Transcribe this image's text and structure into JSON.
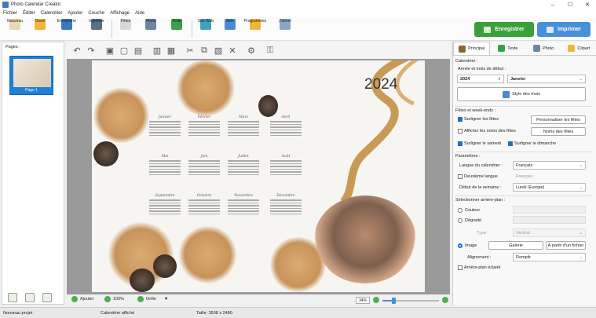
{
  "window": {
    "title": "Photo Calendar Creator",
    "controls": [
      "–",
      "☐",
      "✕"
    ]
  },
  "menu": [
    "Fichier",
    "Éditer",
    "Calendrier",
    "Ajouter",
    "Couche",
    "Affichage",
    "Aide"
  ],
  "toolbar": {
    "buttons": [
      {
        "label": "Nouveau",
        "icon": "new-file-icon",
        "color": "#e9d9b0"
      },
      {
        "label": "Ouvrir",
        "icon": "open-folder-icon",
        "color": "#f0b53a"
      },
      {
        "label": "Enregistrer",
        "icon": "save-icon",
        "color": "#3b78c6"
      },
      {
        "label": "Imprimer",
        "icon": "print-icon",
        "color": "#5a6e8a"
      },
      {
        "label": "Fêtes",
        "icon": "holidays-icon",
        "color": "#d8d8d8"
      },
      {
        "label": "Photo",
        "icon": "photo-icon",
        "color": "#6e86a3"
      },
      {
        "label": "Texte",
        "icon": "text-icon",
        "color": "#3aa04a"
      },
      {
        "label": "Site Web",
        "icon": "website-icon",
        "color": "#3fa1c4"
      },
      {
        "label": "Aide",
        "icon": "help-icon",
        "color": "#4a8ad6"
      },
      {
        "label": "Programmes",
        "icon": "programs-icon",
        "color": "#f0b53a"
      },
      {
        "label": "J'aime!",
        "icon": "like-icon",
        "color": "#8aa6c8"
      }
    ],
    "save_label": "Enregistrer",
    "print_label": "Imprimer"
  },
  "pages_panel": {
    "header": "Pages :",
    "thumb_label": "Page 1"
  },
  "page": {
    "year": "2024",
    "months": [
      "Janvier",
      "Février",
      "Mars",
      "Avril",
      "Mai",
      "Juin",
      "Juillet",
      "Août",
      "Septembre",
      "Octobre",
      "Novembre",
      "Décembre"
    ]
  },
  "canvas_status": {
    "add_label": "Ajouter",
    "zoom_label": "100%",
    "grid_label": "Grille",
    "zoom_value": "34%",
    "zoom_slider_fraction": 0.2
  },
  "statusbar": {
    "project": "Nouveau projet",
    "displayed": "Calendrier affiché",
    "size": "Taille: 3508 x 2480"
  },
  "right_panel": {
    "tabs": [
      {
        "label": "Principal",
        "icon": "main-tab-icon",
        "color": "#8a6a2a"
      },
      {
        "label": "Texte",
        "icon": "text-tab-icon",
        "color": "#3aa04a"
      },
      {
        "label": "Photo",
        "icon": "photo-tab-icon",
        "color": "#6e86a3"
      },
      {
        "label": "Clipart",
        "icon": "clipart-tab-icon",
        "color": "#f0b53a"
      }
    ],
    "calendar": {
      "section": "Calendrier :",
      "year_month_label": "Année et mois de début :",
      "year": "2024",
      "month": "Janvier",
      "style_button": "Style des mois"
    },
    "holidays": {
      "section": "Fêtes et week-ends :",
      "highlight_holidays": "Surligner les fêtes",
      "customize_holidays": "Personnaliser les fêtes",
      "show_names": "Afficher les noms des fêtes",
      "holiday_names": "Noms des fêtes",
      "highlight_saturday": "Surligner le samedi",
      "highlight_sunday": "Surligner le dimanche"
    },
    "params": {
      "section": "Paramètres :",
      "language_label": "Langue du calendrier :",
      "language_value": "Français",
      "second_language": "Deuxième langue",
      "second_language_value": "Français",
      "week_start_label": "Début de la semaine :",
      "week_start_value": "Lundi (Europe)"
    },
    "background": {
      "section": "Sélectionner arrière-plan :",
      "color": "Couleur",
      "gradient": "Dégradé",
      "type_label": "Type :",
      "type_value": "Vertical",
      "image": "Image",
      "gallery": "Galerie",
      "from_file": "À partir d'un fichier",
      "alignment_label": "Alignement :",
      "alignment_value": "Remplir",
      "lighten": "Arrière-plan éclairé"
    }
  }
}
